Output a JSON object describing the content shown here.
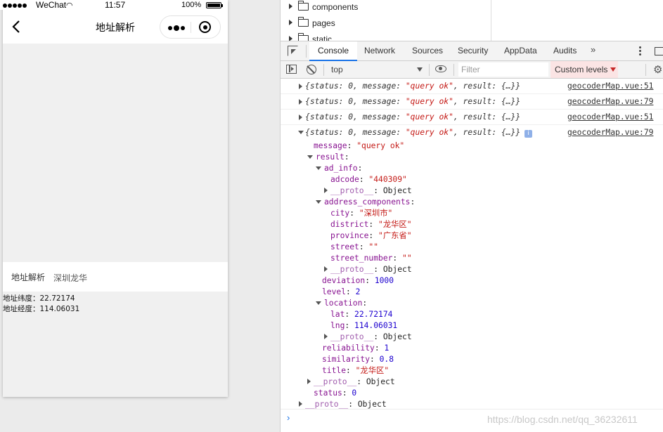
{
  "phone": {
    "status_bar": {
      "carrier": "WeChat",
      "time": "11:57",
      "battery": "100%"
    },
    "nav": {
      "title": "地址解析"
    },
    "form": {
      "label": "地址解析",
      "value": "深圳龙华"
    },
    "results": [
      "地址纬度：22.72174",
      "地址经度：114.06031"
    ]
  },
  "file_tree": {
    "items": [
      "components",
      "pages",
      "static"
    ]
  },
  "devtools": {
    "tabs": [
      "Console",
      "Network",
      "Sources",
      "Security",
      "AppData",
      "Audits"
    ],
    "active_tab": "Console",
    "more_tabs": "»",
    "context": "top",
    "filter_placeholder": "Filter",
    "levels": "Custom levels",
    "prompt": "›",
    "watermark": "https://blog.csdn.net/qq_36232611"
  },
  "logs": [
    {
      "key1": "status",
      "v1": "0",
      "key2": "message",
      "v2": "\"query ok\"",
      "key3": "result",
      "v3": "{…}",
      "source": "geocoderMap.vue:51",
      "expanded": false
    },
    {
      "key1": "status",
      "v1": "0",
      "key2": "message",
      "v2": "\"query ok\"",
      "key3": "result",
      "v3": "{…}",
      "source": "geocoderMap.vue:79",
      "expanded": false
    },
    {
      "key1": "status",
      "v1": "0",
      "key2": "message",
      "v2": "\"query ok\"",
      "key3": "result",
      "v3": "{…}",
      "source": "geocoderMap.vue:51",
      "expanded": false
    },
    {
      "key1": "status",
      "v1": "0",
      "key2": "message",
      "v2": "\"query ok\"",
      "key3": "result",
      "v3": "{…}",
      "source": "geocoderMap.vue:79",
      "expanded": true,
      "badge": "i"
    }
  ],
  "object_tree": [
    {
      "indent": 0,
      "toggle": "none",
      "key": "message",
      "value": "\"query ok\"",
      "vtype": "s"
    },
    {
      "indent": 0,
      "toggle": "open",
      "key": "result",
      "value": "",
      "vtype": ""
    },
    {
      "indent": 1,
      "toggle": "open",
      "key": "ad_info",
      "value": "",
      "vtype": ""
    },
    {
      "indent": 2,
      "toggle": "none",
      "key": "adcode",
      "value": "\"440309\"",
      "vtype": "s"
    },
    {
      "indent": 2,
      "toggle": "closed",
      "key": "__proto__",
      "value": "Object",
      "vtype": "o",
      "dim": true
    },
    {
      "indent": 1,
      "toggle": "open",
      "key": "address_components",
      "value": "",
      "vtype": ""
    },
    {
      "indent": 2,
      "toggle": "none",
      "key": "city",
      "value": "\"深圳市\"",
      "vtype": "s"
    },
    {
      "indent": 2,
      "toggle": "none",
      "key": "district",
      "value": "\"龙华区\"",
      "vtype": "s"
    },
    {
      "indent": 2,
      "toggle": "none",
      "key": "province",
      "value": "\"广东省\"",
      "vtype": "s"
    },
    {
      "indent": 2,
      "toggle": "none",
      "key": "street",
      "value": "\"\"",
      "vtype": "s"
    },
    {
      "indent": 2,
      "toggle": "none",
      "key": "street_number",
      "value": "\"\"",
      "vtype": "s"
    },
    {
      "indent": 2,
      "toggle": "closed",
      "key": "__proto__",
      "value": "Object",
      "vtype": "o",
      "dim": true
    },
    {
      "indent": 1,
      "toggle": "none",
      "key": "deviation",
      "value": "1000",
      "vtype": "n"
    },
    {
      "indent": 1,
      "toggle": "none",
      "key": "level",
      "value": "2",
      "vtype": "n"
    },
    {
      "indent": 1,
      "toggle": "open",
      "key": "location",
      "value": "",
      "vtype": ""
    },
    {
      "indent": 2,
      "toggle": "none",
      "key": "lat",
      "value": "22.72174",
      "vtype": "n"
    },
    {
      "indent": 2,
      "toggle": "none",
      "key": "lng",
      "value": "114.06031",
      "vtype": "n"
    },
    {
      "indent": 2,
      "toggle": "closed",
      "key": "__proto__",
      "value": "Object",
      "vtype": "o",
      "dim": true
    },
    {
      "indent": 1,
      "toggle": "none",
      "key": "reliability",
      "value": "1",
      "vtype": "n"
    },
    {
      "indent": 1,
      "toggle": "none",
      "key": "similarity",
      "value": "0.8",
      "vtype": "n"
    },
    {
      "indent": 1,
      "toggle": "none",
      "key": "title",
      "value": "\"龙华区\"",
      "vtype": "s"
    },
    {
      "indent": 0,
      "toggle": "closed",
      "key": "__proto__",
      "value": "Object",
      "vtype": "o",
      "dim": true
    },
    {
      "indent": 0,
      "toggle": "none",
      "key": "status",
      "value": "0",
      "vtype": "n"
    },
    {
      "indent": -1,
      "toggle": "closed",
      "key": "__proto__",
      "value": "Object",
      "vtype": "o",
      "dim": true
    }
  ]
}
